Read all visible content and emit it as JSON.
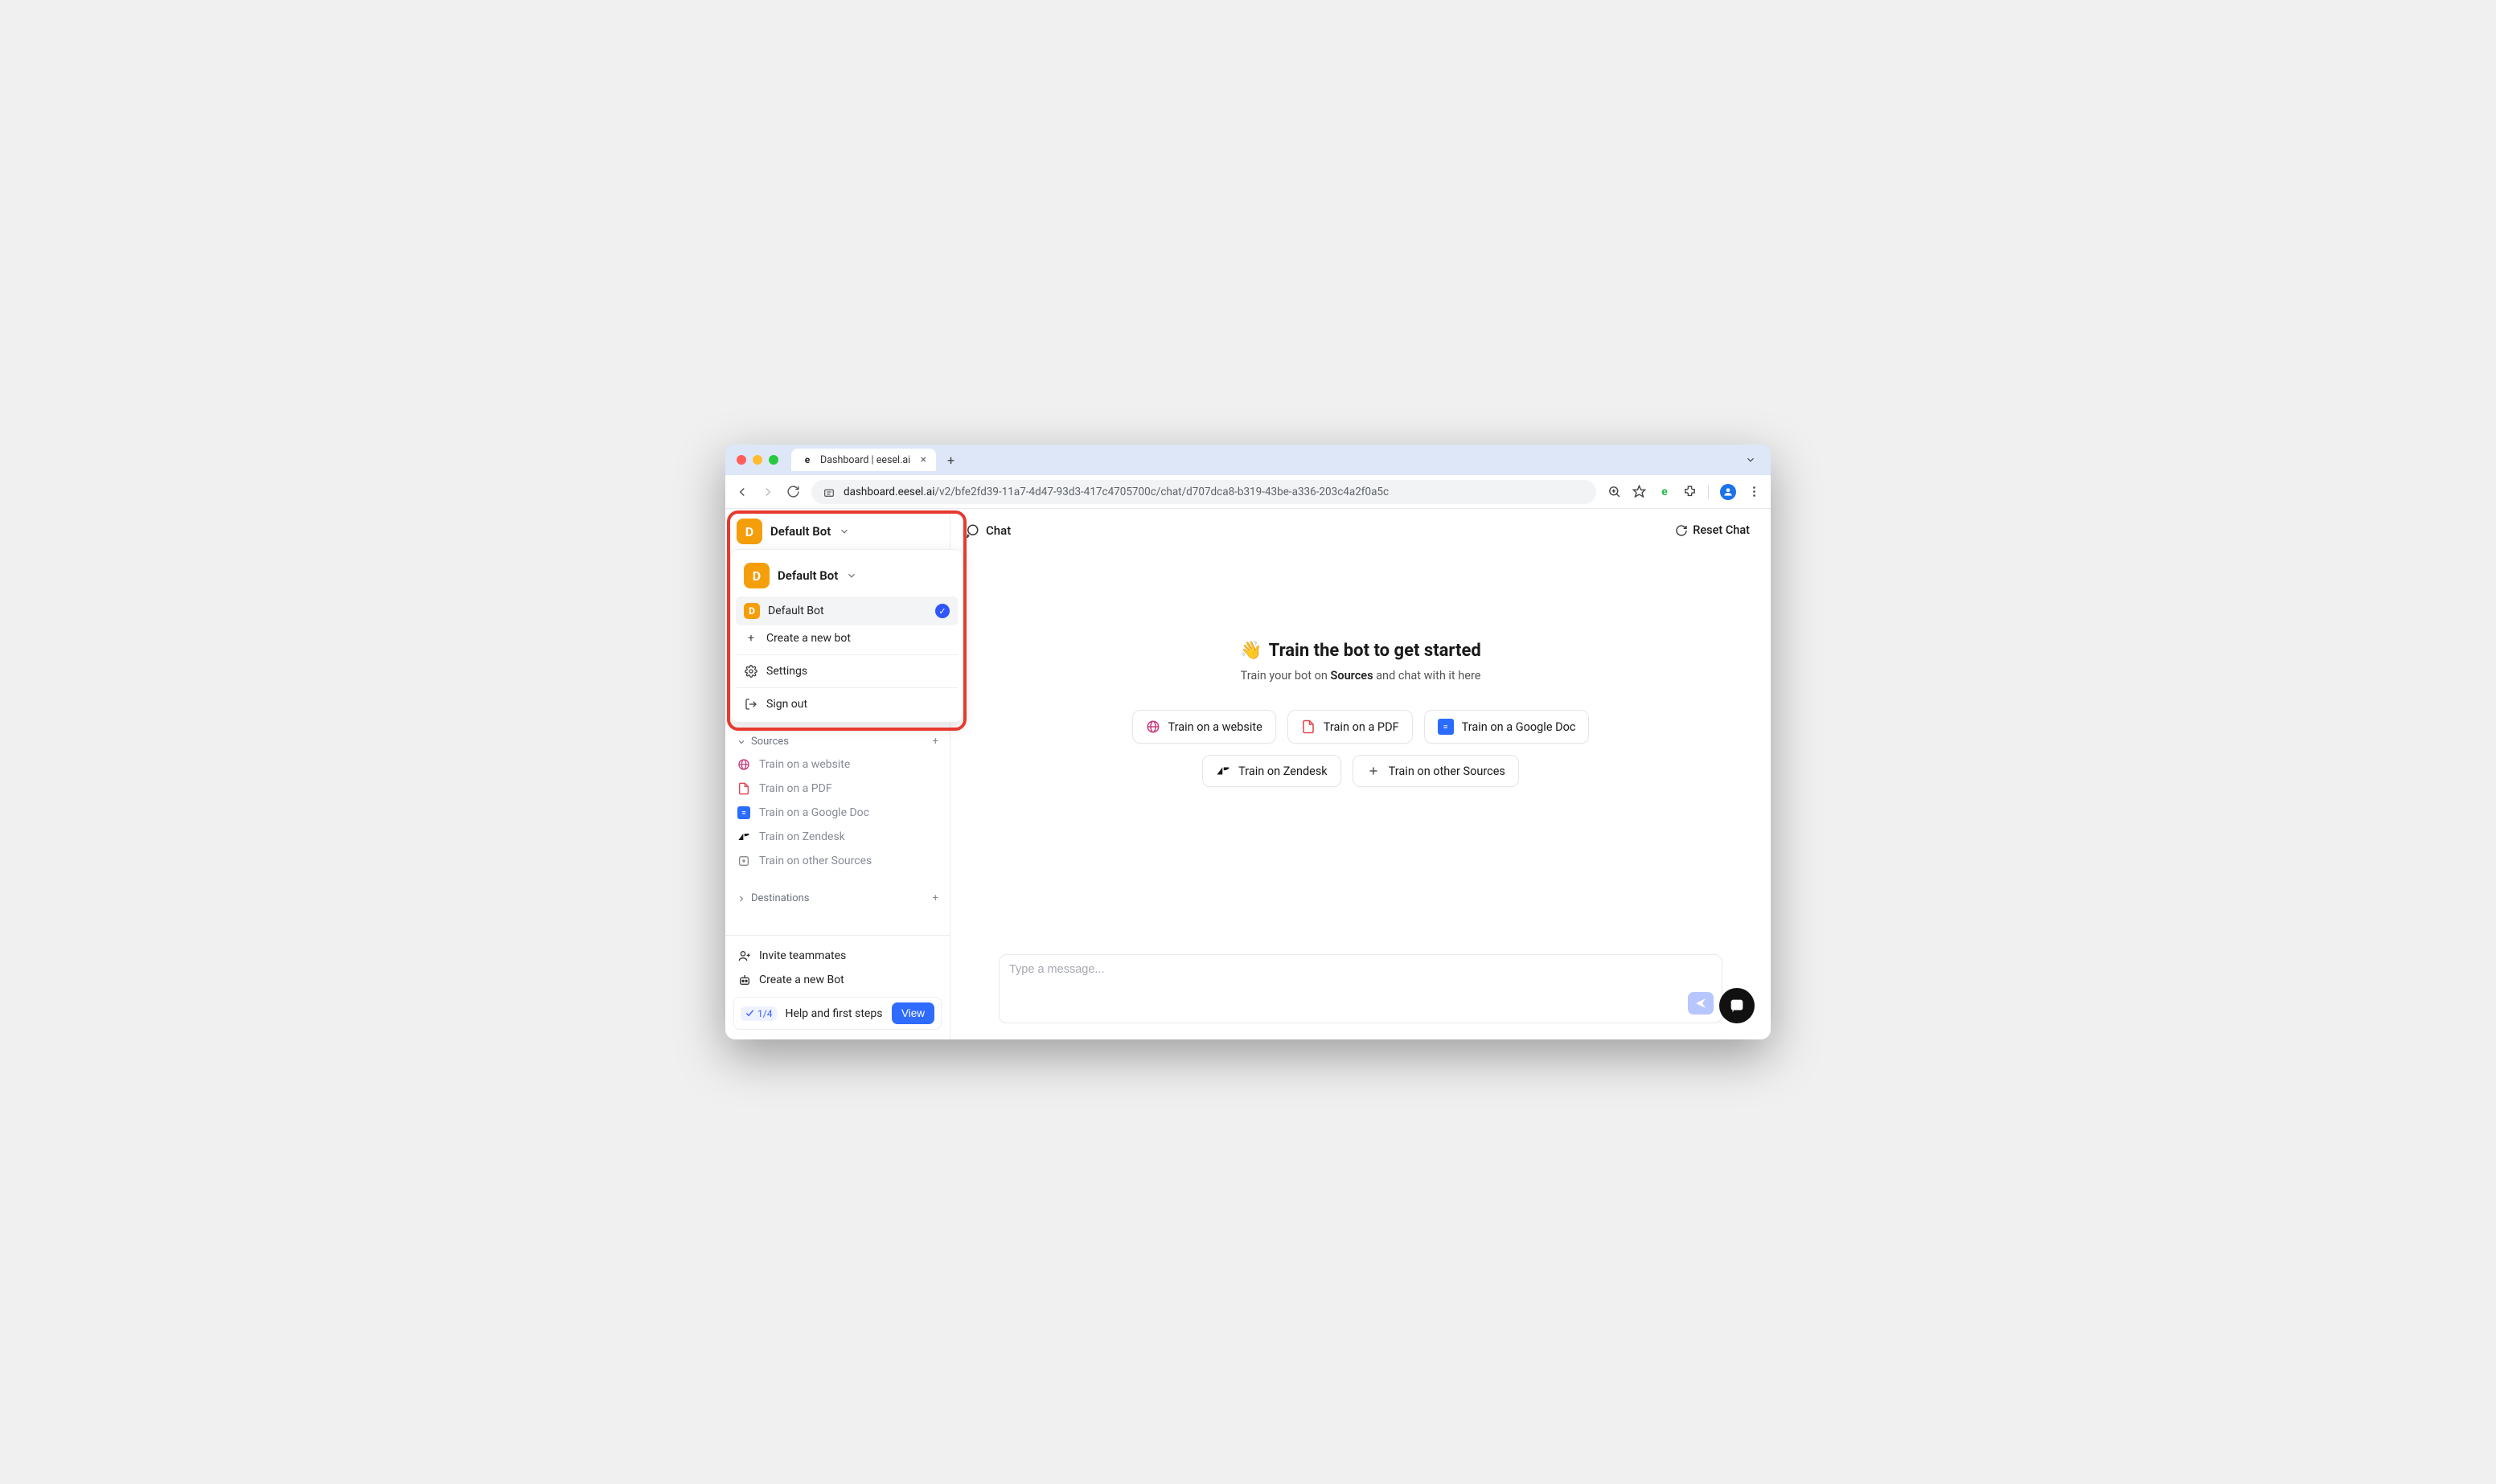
{
  "browser": {
    "tab_title": "Dashboard | eesel.ai",
    "url_main": "dashboard.eesel.ai",
    "url_rest": "/v2/bfe2fd39-11a7-4d47-93d3-417c4705700c/chat/d707dca8-b319-43be-a336-203c4a2f0a5c"
  },
  "sidebar": {
    "bot_initial": "D",
    "bot_name": "Default Bot",
    "dropdown": {
      "default_bot": "Default Bot",
      "create_bot": "Create a new bot",
      "settings": "Settings",
      "signout": "Sign out"
    },
    "sources_header": "Sources",
    "train_website": "Train on a website",
    "train_pdf": "Train on a PDF",
    "train_gdoc": "Train on a Google Doc",
    "train_zendesk": "Train on Zendesk",
    "train_other": "Train on other Sources",
    "destinations_header": "Destinations",
    "invite": "Invite teammates",
    "create_bot_bottom": "Create a new Bot",
    "help_badge": "1/4",
    "help_text": "Help and first steps",
    "view_btn": "View"
  },
  "main": {
    "chat_label": "Chat",
    "reset_label": "Reset Chat",
    "hero_emoji": "👋",
    "hero_title": "Train the bot to get started",
    "hero_sub_pre": "Train your bot on ",
    "hero_sub_bold": "Sources",
    "hero_sub_post": " and chat with it here",
    "chip_website": "Train on a website",
    "chip_pdf": "Train on a PDF",
    "chip_gdoc": "Train on a Google Doc",
    "chip_zendesk": "Train on Zendesk",
    "chip_other": "Train on other Sources",
    "compose_placeholder": "Type a message..."
  }
}
